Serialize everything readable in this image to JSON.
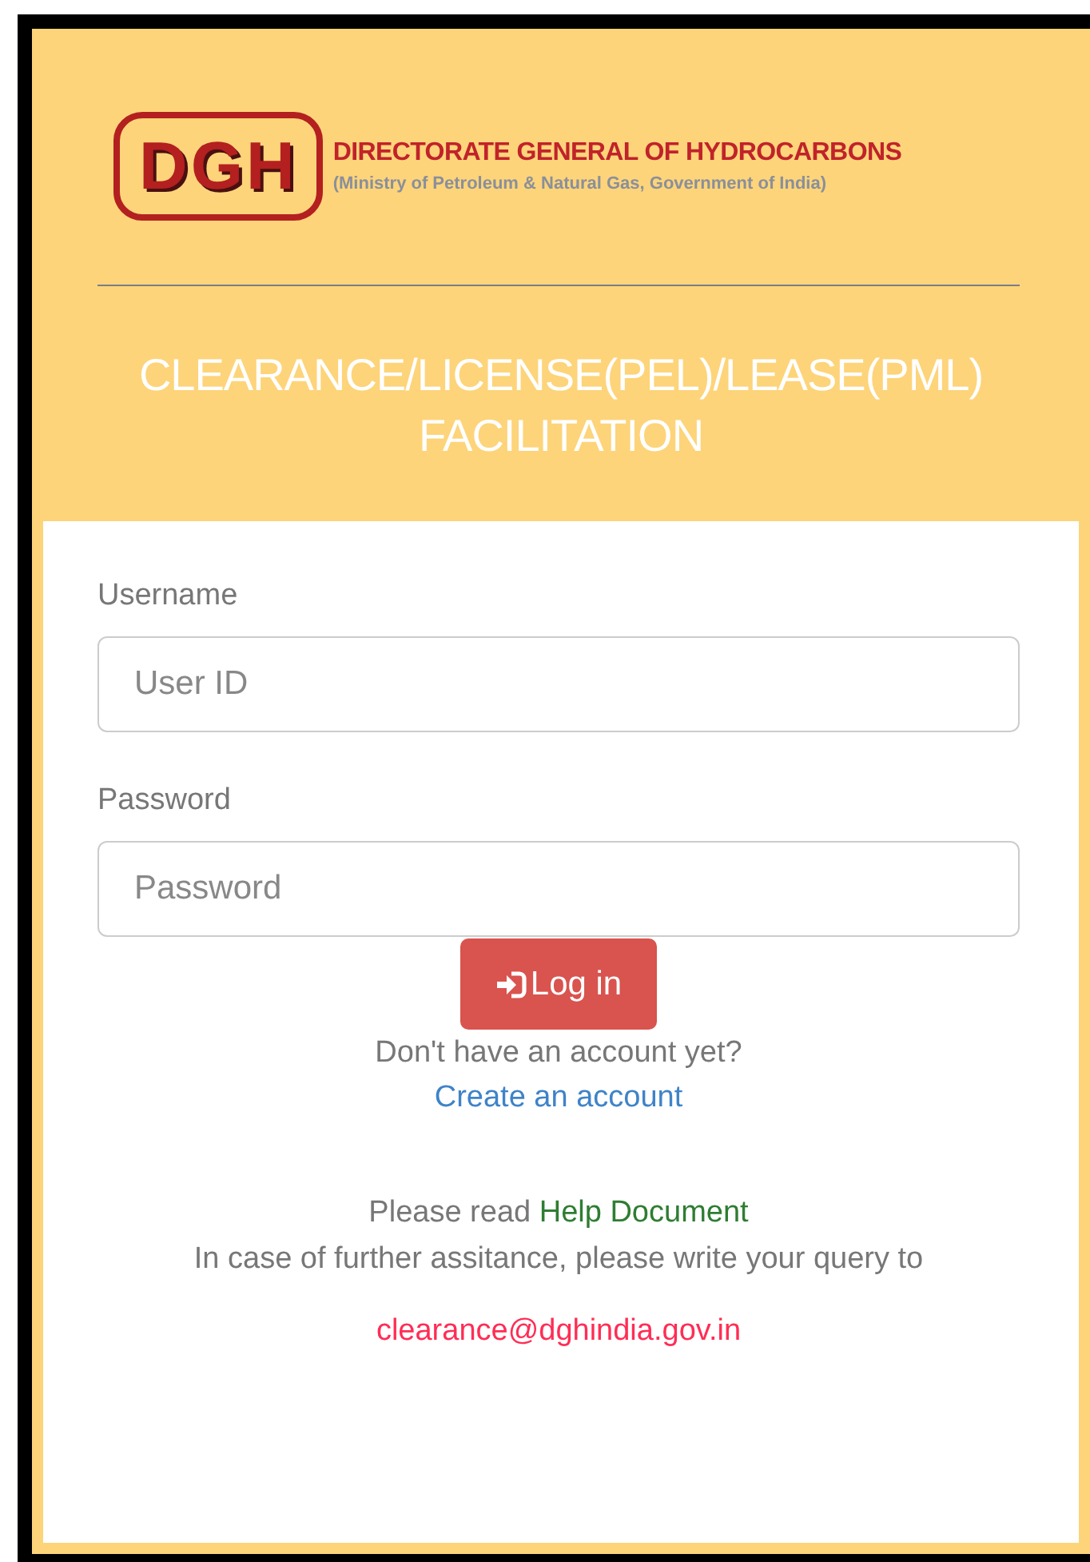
{
  "logo": {
    "mark": "DGH",
    "name": "DIRECTORATE GENERAL OF HYDROCARBONS",
    "subtitle": "(Ministry of Petroleum & Natural Gas, Government of India)"
  },
  "title": [
    "CLEARANCE/LICENSE(PEL)/LEASE(PML)",
    "FACILITATION"
  ],
  "fields": [
    {
      "label": "Username",
      "placeholder": "User ID"
    },
    {
      "label": "Password",
      "placeholder": "Password"
    }
  ],
  "login_button": "Log in",
  "signup": {
    "prompt": "Don't have an account yet?",
    "link": "Create an account"
  },
  "help": {
    "prefix": "Please read",
    "link": "Help Document",
    "note": "In case of further assitance, please write your query to",
    "email": "clearance@dghindia.gov.in"
  }
}
